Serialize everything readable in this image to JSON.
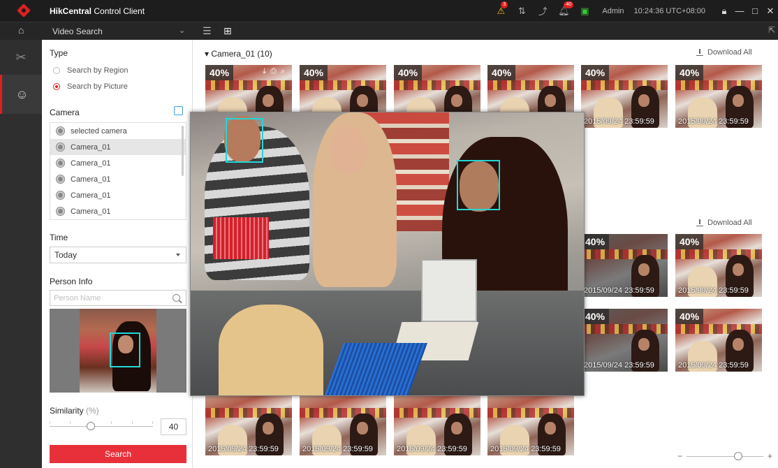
{
  "titlebar": {
    "app_name_bold": "HikCentral",
    "app_name_rest": " Control Client",
    "badges": {
      "alarm": "3",
      "notify": "40"
    },
    "user": "Admin",
    "clock": "10:24:36 UTC+08:00"
  },
  "toolbar": {
    "module": "Video Search"
  },
  "panel": {
    "type_label": "Type",
    "radio_region": "Search by Region",
    "radio_picture": "Search by Picture",
    "camera_label": "Camera",
    "cameras": [
      "selected camera",
      "Camera_01",
      "Camera_01",
      "Camera_01",
      "Camera_01",
      "Camera_01"
    ],
    "time_label": "Time",
    "time_value": "Today",
    "person_label": "Person Info",
    "person_placeholder": "Person Name",
    "similarity_label": "Similarity",
    "similarity_unit": "(%)",
    "similarity_value": "40",
    "search_button": "Search"
  },
  "results": {
    "group_title": "Camera_01 (10)",
    "download_all": "Download All",
    "percent": "40%",
    "timestamp": "2015/09/24 23:59:59"
  },
  "colors": {
    "accent": "#e8303a",
    "face_box": "#24d6d6"
  }
}
